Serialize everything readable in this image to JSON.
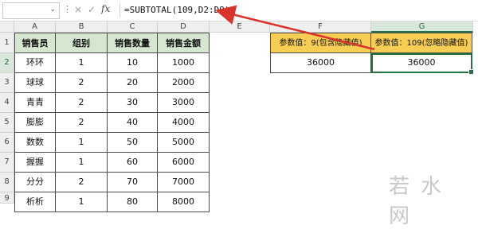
{
  "formula_bar": {
    "name_box": "",
    "formula": "=SUBTOTAL(109,D2:D9)",
    "fx_label": "fx",
    "cancel_glyph": "×",
    "enter_glyph": "✓"
  },
  "columns": [
    "A",
    "B",
    "C",
    "D",
    "E",
    "F",
    "G"
  ],
  "selected_column": "G",
  "rows": [
    "1",
    "2",
    "3",
    "4",
    "5",
    "6",
    "7",
    "8",
    "9"
  ],
  "selected_row": "2",
  "table": {
    "headers": [
      "销售员",
      "组别",
      "销售数量",
      "销售金额"
    ],
    "rows": [
      [
        "环环",
        "1",
        "10",
        "1000"
      ],
      [
        "球球",
        "2",
        "20",
        "2000"
      ],
      [
        "青青",
        "2",
        "30",
        "3000"
      ],
      [
        "膨膨",
        "2",
        "40",
        "4000"
      ],
      [
        "数数",
        "1",
        "50",
        "5000"
      ],
      [
        "握握",
        "1",
        "60",
        "6000"
      ],
      [
        "分分",
        "2",
        "70",
        "7000"
      ],
      [
        "析析",
        "1",
        "80",
        "8000"
      ]
    ]
  },
  "summary": {
    "f1": "参数值：9(包含隐藏值)",
    "g1": "参数值：109(忽略隐藏值)",
    "f2": "36000",
    "g2": "36000"
  },
  "watermark": "若水网",
  "colors": {
    "accent": "#217346",
    "header_fill": "#d5e8cf",
    "label_fill": "#f8cd53",
    "arrow": "#d9342b"
  }
}
